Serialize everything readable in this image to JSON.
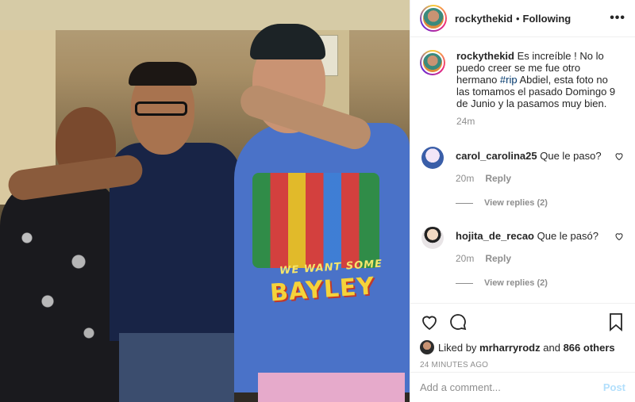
{
  "post": {
    "image_description_icon": "photo-icon"
  },
  "header": {
    "username": "rockythekid",
    "separator": "•",
    "follow_status": "Following",
    "more_icon": "more-options-icon"
  },
  "caption": {
    "username": "rockythekid",
    "text_before_tag": "Es increíble ! No lo puedo creer se me fue otro hermano ",
    "hashtag": "#rip",
    "text_after_tag": " Abdiel, esta foto no las tomamos el pasado Domingo 9 de Junio y la pasamos muy bien.",
    "time": "24m"
  },
  "comments": [
    {
      "username": "carol_carolina25",
      "text": "Que le paso?",
      "time": "20m",
      "reply_label": "Reply",
      "view_replies": "View replies (2)"
    },
    {
      "username": "hojita_de_recao",
      "text": "Que le pasó?",
      "time": "20m",
      "reply_label": "Reply",
      "view_replies": "View replies (2)"
    }
  ],
  "likes": {
    "prefix": "Liked by",
    "user": "mrharryrodz",
    "connector": "and",
    "others": "866 others"
  },
  "timestamp": "24 MINUTES AGO",
  "add_comment": {
    "placeholder": "Add a comment...",
    "post_label": "Post"
  },
  "shirt": {
    "line1": "WE WANT SOME",
    "line2": "BAYLEY"
  }
}
